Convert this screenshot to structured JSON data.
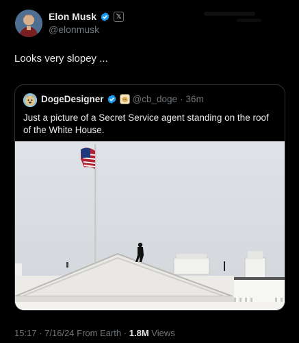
{
  "author": {
    "name": "Elon Musk",
    "handle": "@elonmusk",
    "badge_icon": "x-logo-icon"
  },
  "tweet": {
    "text": "Looks very slopey ..."
  },
  "quoted": {
    "name": "DogeDesigner",
    "handle": "@cb_doge",
    "separator": "·",
    "time": "36m",
    "text": "Just a picture of a Secret Service agent standing on the roof of the White House."
  },
  "meta": {
    "time": "15:17",
    "date": "7/16/24",
    "source": "From Earth",
    "sep": "·",
    "views_count": "1.8M",
    "views_label": "Views"
  },
  "colors": {
    "background": "#000000",
    "text_primary": "#e7e9ea",
    "text_secondary": "#71767b",
    "verified_blue": "#1d9bf0",
    "border": "#2f3336"
  }
}
